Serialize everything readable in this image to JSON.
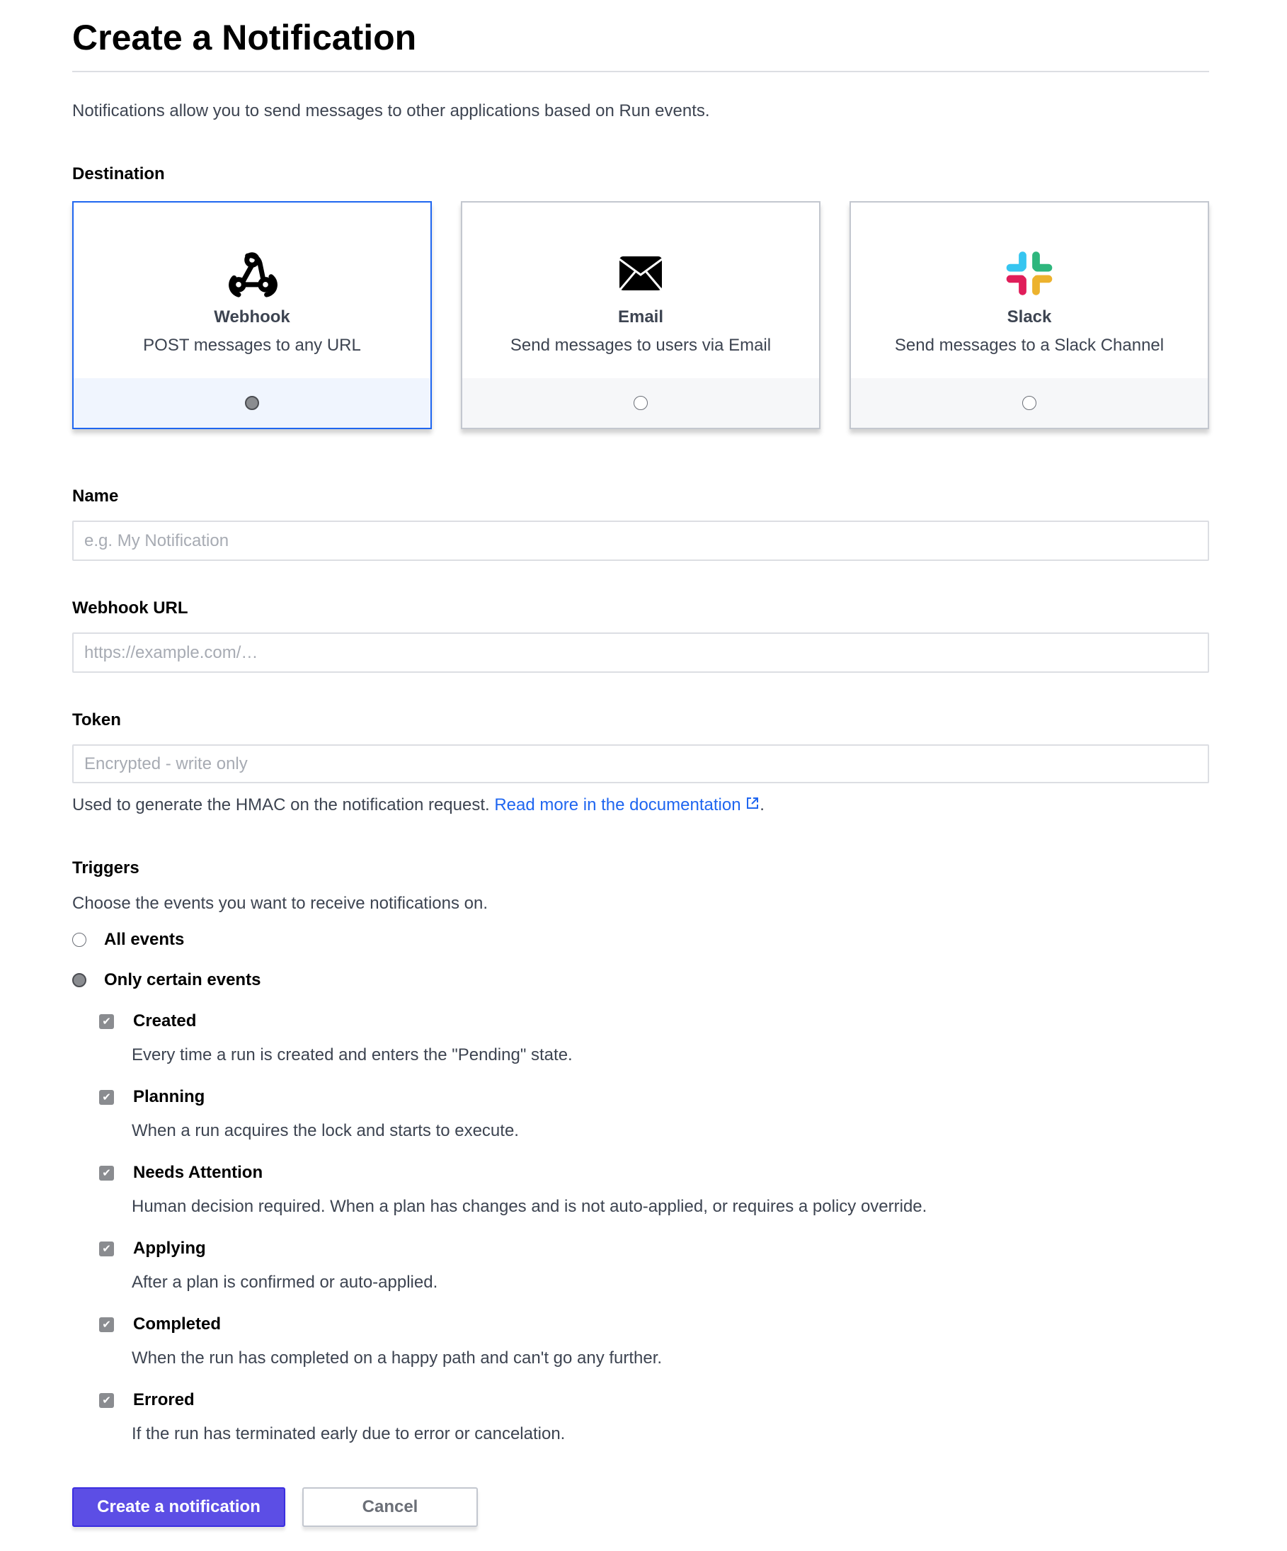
{
  "title": "Create a Notification",
  "intro": "Notifications allow you to send messages to other applications based on Run events.",
  "destination": {
    "label": "Destination",
    "selected": "Webhook",
    "accent": "#1f66f0",
    "cards": [
      {
        "title": "Webhook",
        "desc": "POST messages to any URL",
        "icon": "webhook-icon"
      },
      {
        "title": "Email",
        "desc": "Send messages to users via Email",
        "icon": "envelope-icon"
      },
      {
        "title": "Slack",
        "desc": "Send messages to a Slack Channel",
        "icon": "slack-icon"
      }
    ]
  },
  "name": {
    "label": "Name",
    "placeholder": "e.g. My Notification",
    "value": ""
  },
  "webhook_url": {
    "label": "Webhook URL",
    "placeholder": "https://example.com/…",
    "value": ""
  },
  "token": {
    "label": "Token",
    "placeholder": "Encrypted - write only",
    "value": "",
    "help": "Used to generate the HMAC on the notification request. ",
    "link": "Read more in the documentation",
    "after": "."
  },
  "triggers": {
    "label": "Triggers",
    "desc": "Choose the events you want to receive notifications on.",
    "all": "All events",
    "certain": "Only certain events",
    "selected": "Only certain events",
    "events": [
      {
        "name": "Created",
        "desc": "Every time a run is created and enters the \"Pending\" state.",
        "checked": true
      },
      {
        "name": "Planning",
        "desc": "When a run acquires the lock and starts to execute.",
        "checked": true
      },
      {
        "name": "Needs Attention",
        "desc": "Human decision required. When a plan has changes and is not auto-applied, or requires a policy override.",
        "checked": true
      },
      {
        "name": "Applying",
        "desc": "After a plan is confirmed or auto-applied.",
        "checked": true
      },
      {
        "name": "Completed",
        "desc": "When the run has completed on a happy path and can't go any further.",
        "checked": true
      },
      {
        "name": "Errored",
        "desc": "If the run has terminated early due to error or cancelation.",
        "checked": true
      }
    ]
  },
  "actions": {
    "create": "Create a notification",
    "cancel": "Cancel",
    "primary_color": "#5c4ee5"
  }
}
